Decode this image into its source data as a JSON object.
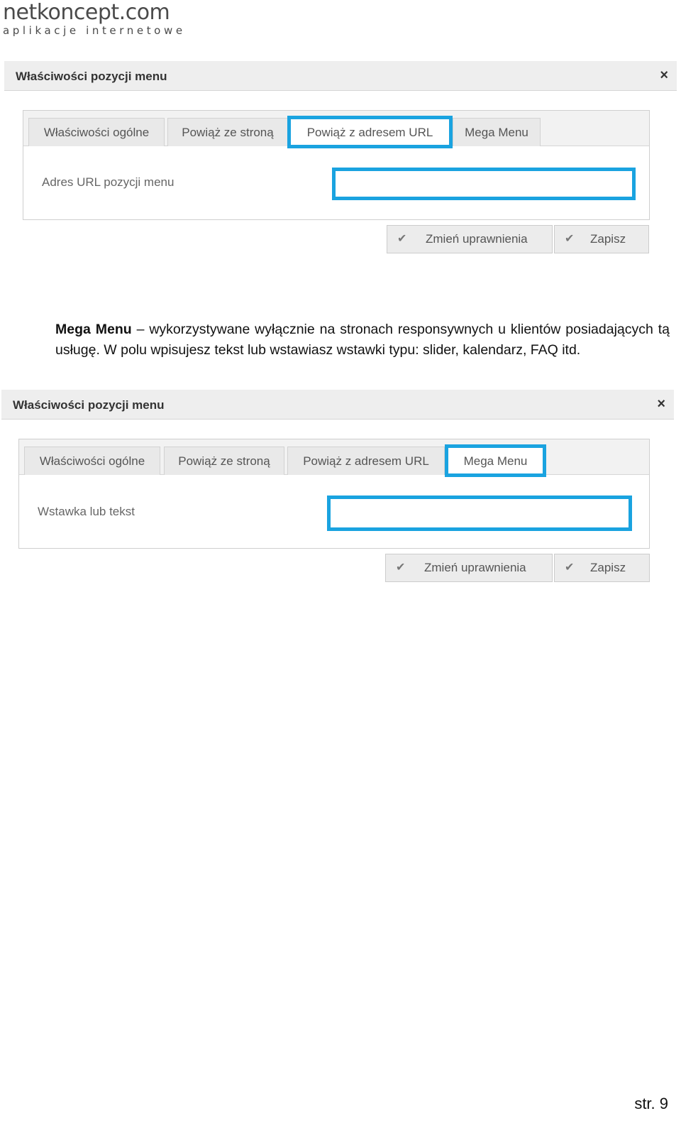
{
  "logo": {
    "name": "netkoncept.com",
    "tagline": "aplikacje internetowe"
  },
  "dialog1": {
    "title": "Właściwości pozycji menu",
    "close_icon": "×",
    "tabs": [
      {
        "label": "Właściwości ogólne"
      },
      {
        "label": "Powiąż ze stroną"
      },
      {
        "label": "Powiąż z adresem URL"
      },
      {
        "label": "Mega Menu"
      }
    ],
    "active_tab": "Powiąż z adresem URL",
    "field_label": "Adres URL pozycji menu",
    "field_value": "",
    "buttons": {
      "permissions": "Zmień uprawnienia",
      "save": "Zapisz"
    },
    "check_icon": "✔"
  },
  "description": {
    "term": "Mega Menu",
    "dash": "–",
    "text": "wykorzystywane wyłącznie na stronach responsywnych u klientów posiadających tą usługę. W polu wpisujesz tekst lub wstawiasz wstawki typu: slider, kalendarz, FAQ itd."
  },
  "dialog2": {
    "title": "Właściwości pozycji menu",
    "close_icon": "×",
    "tabs": [
      {
        "label": "Właściwości ogólne"
      },
      {
        "label": "Powiąż ze stroną"
      },
      {
        "label": "Powiąż z adresem URL"
      },
      {
        "label": "Mega Menu"
      }
    ],
    "active_tab": "Mega Menu",
    "field_label": "Wstawka lub tekst",
    "field_value": "",
    "buttons": {
      "permissions": "Zmień uprawnienia",
      "save": "Zapisz"
    },
    "check_icon": "✔"
  },
  "page_number": "str. 9",
  "colors": {
    "highlight": "#1aa3e0",
    "title_bar": "#eeeeee",
    "button": "#ececec"
  }
}
